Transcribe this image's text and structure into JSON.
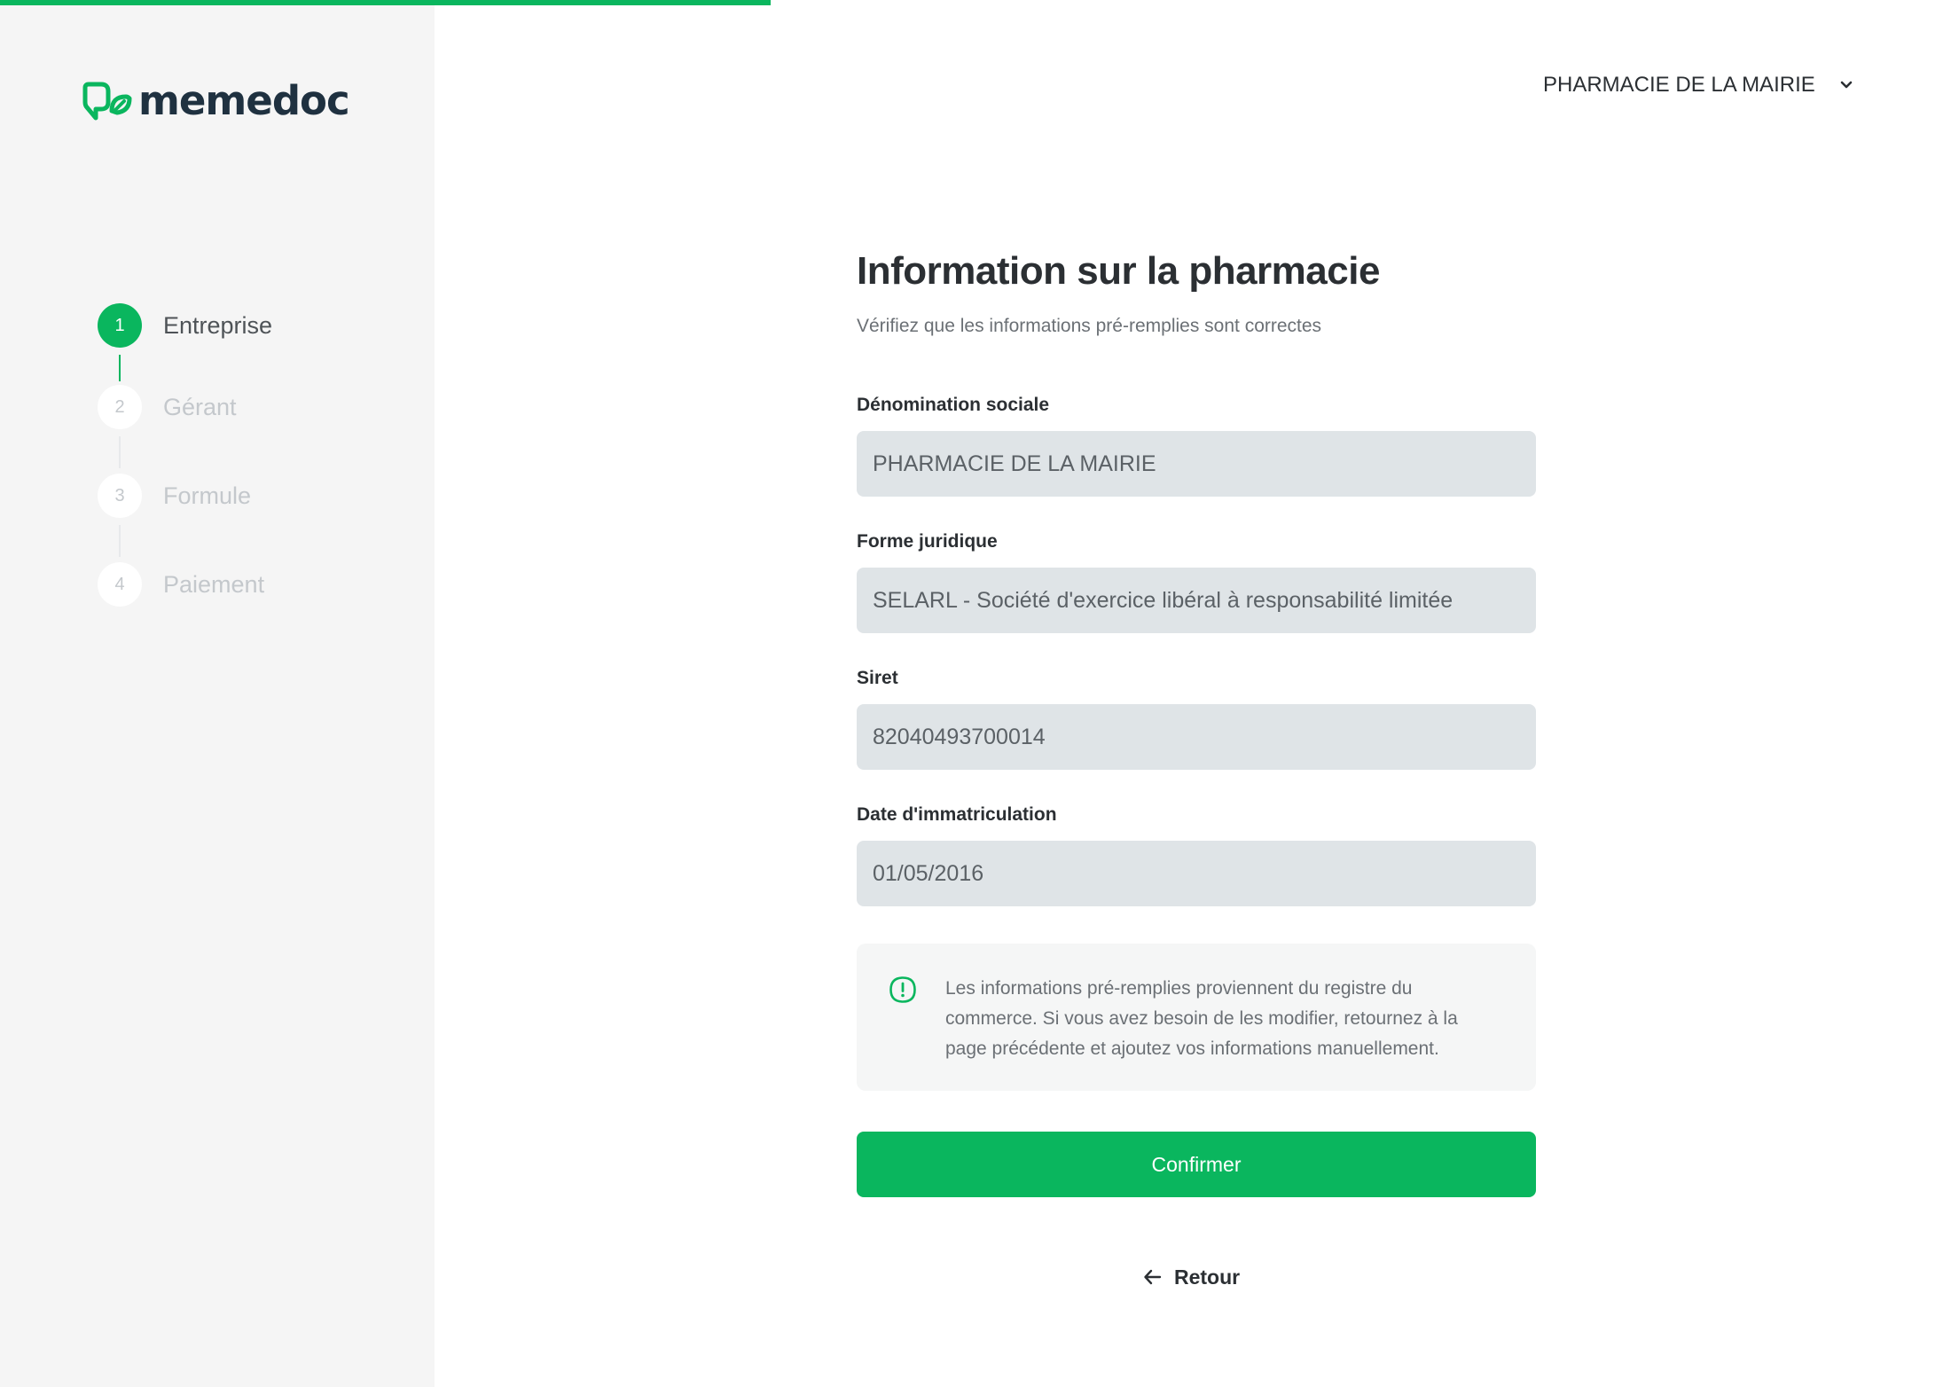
{
  "progress": {
    "fraction": 0.395
  },
  "brand": {
    "logo_text": "memedoc"
  },
  "steps": [
    {
      "number": "1",
      "label": "Entreprise",
      "active": true
    },
    {
      "number": "2",
      "label": "Gérant",
      "active": false
    },
    {
      "number": "3",
      "label": "Formule",
      "active": false
    },
    {
      "number": "4",
      "label": "Paiement",
      "active": false
    }
  ],
  "account": {
    "name": "PHARMACIE DE LA MAIRIE"
  },
  "form": {
    "title": "Information sur la pharmacie",
    "subtitle": "Vérifiez que les informations pré-remplies sont correctes",
    "fields": [
      {
        "label": "Dénomination sociale",
        "value": "PHARMACIE DE LA MAIRIE"
      },
      {
        "label": "Forme juridique",
        "value": "SELARL - Société d'exercice libéral à responsabilité limitée"
      },
      {
        "label": "Siret",
        "value": "82040493700014"
      },
      {
        "label": "Date d'immatriculation",
        "value": "01/05/2016"
      }
    ],
    "notice": "Les informations pré-remplies proviennent du registre du commerce. Si vous avez besoin de les modifier, retournez à la page précédente et ajoutez vos informations manuellement.",
    "confirm_label": "Confirmer",
    "back_label": "Retour"
  },
  "colors": {
    "accent": "#0ab65e",
    "sidebar_bg": "#f5f5f5",
    "input_bg": "#dfe4e7",
    "text_dark": "#2b2f33"
  },
  "icons": {
    "logo": "memedoc-leaf-icon",
    "account_dropdown": "chevron-down-icon",
    "notice": "alert-circle-icon",
    "back": "arrow-left-icon"
  }
}
